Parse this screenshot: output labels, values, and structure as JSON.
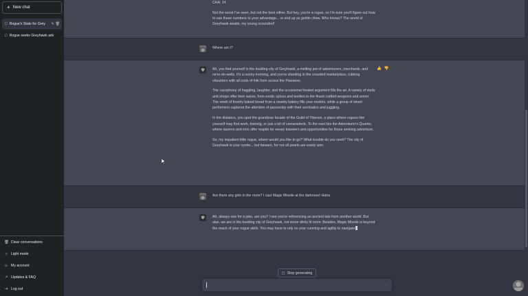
{
  "sidebar": {
    "new_chat": "New chat",
    "chats": [
      {
        "label": "Rogue's Stats for Grey",
        "active": true
      },
      {
        "label": "Rogue seeks Greyhawk adv",
        "active": false
      }
    ],
    "bottom": [
      {
        "label": "Clear conversations",
        "icon": "trash-icon"
      },
      {
        "label": "Light mode",
        "icon": "sun-icon"
      },
      {
        "label": "My account",
        "icon": "user-icon"
      },
      {
        "label": "Updates & FAQ",
        "icon": "external-link-icon"
      },
      {
        "label": "Log out",
        "icon": "logout-icon"
      }
    ]
  },
  "messages": {
    "m0": {
      "role": "assistant",
      "partial_top": "CHA: 14",
      "lines": "Not the worst I've seen, but not the best either. But hey, you're a rogue, so I'm sure you'll figure out how to use these numbers to your advantage... or end up as goblin chow. Who knows? The world of Greyhawk awaits, my young scoundrel!"
    },
    "m1": {
      "role": "user",
      "text": "Where am I?"
    },
    "m2": {
      "role": "assistant",
      "paragraphs": [
        "Ah, you find yourself in the bustling city of Greyhawk, a melting pot of adventurers, merchants, and ne'er-do-wells. It's a sunny morning, and you're standing in the crowded marketplace, rubbing shoulders with all sorts of folk from across the Flanaess.",
        "The cacophony of haggling, laughter, and the occasional heated argument fills the air. A variety of stalls and shops offer their wares, from exotic spices and textiles to the finest crafted weapons and armor. The smell of freshly baked bread from a nearby bakery fills your nostrils, while a group of street performers captures the attention of passersby with their acrobatics and juggling.",
        "In the distance, you spot the grandiose facade of the Guild of Thieves, a place where rogues like yourself may find work, training, or just a bit of camaraderie. To the east lies the Adventurer's Quarter, where taverns and inns offer respite for weary travelers and opportunities for those seeking adventure.",
        "So, my impatient little rogue, where would you like to go? What trouble do you seek? The city of Greyhawk is your oyster... but beware, for not all pearls are easily won."
      ]
    },
    "m3": {
      "role": "user",
      "text": "Are there any girls in the room? I cast Magic Missile at the darkness! Haha"
    },
    "m4": {
      "role": "assistant",
      "text": "Ah, always one for a joke, are you? I see you're referencing an ancient tale from another world. But alas, we are in the bustling city of Greyhawk, not some dimly lit room. Besides, Magic Missile is beyond the reach of your rogue skills. You may have to rely on your cunning and agility to navigate"
    }
  },
  "composer": {
    "stop_label": "Stop generating",
    "input_value": ""
  },
  "colors": {
    "sidebar_bg": "#202123",
    "main_bg": "#343541",
    "assistant_bg": "#444654",
    "input_bg": "#40414f"
  }
}
